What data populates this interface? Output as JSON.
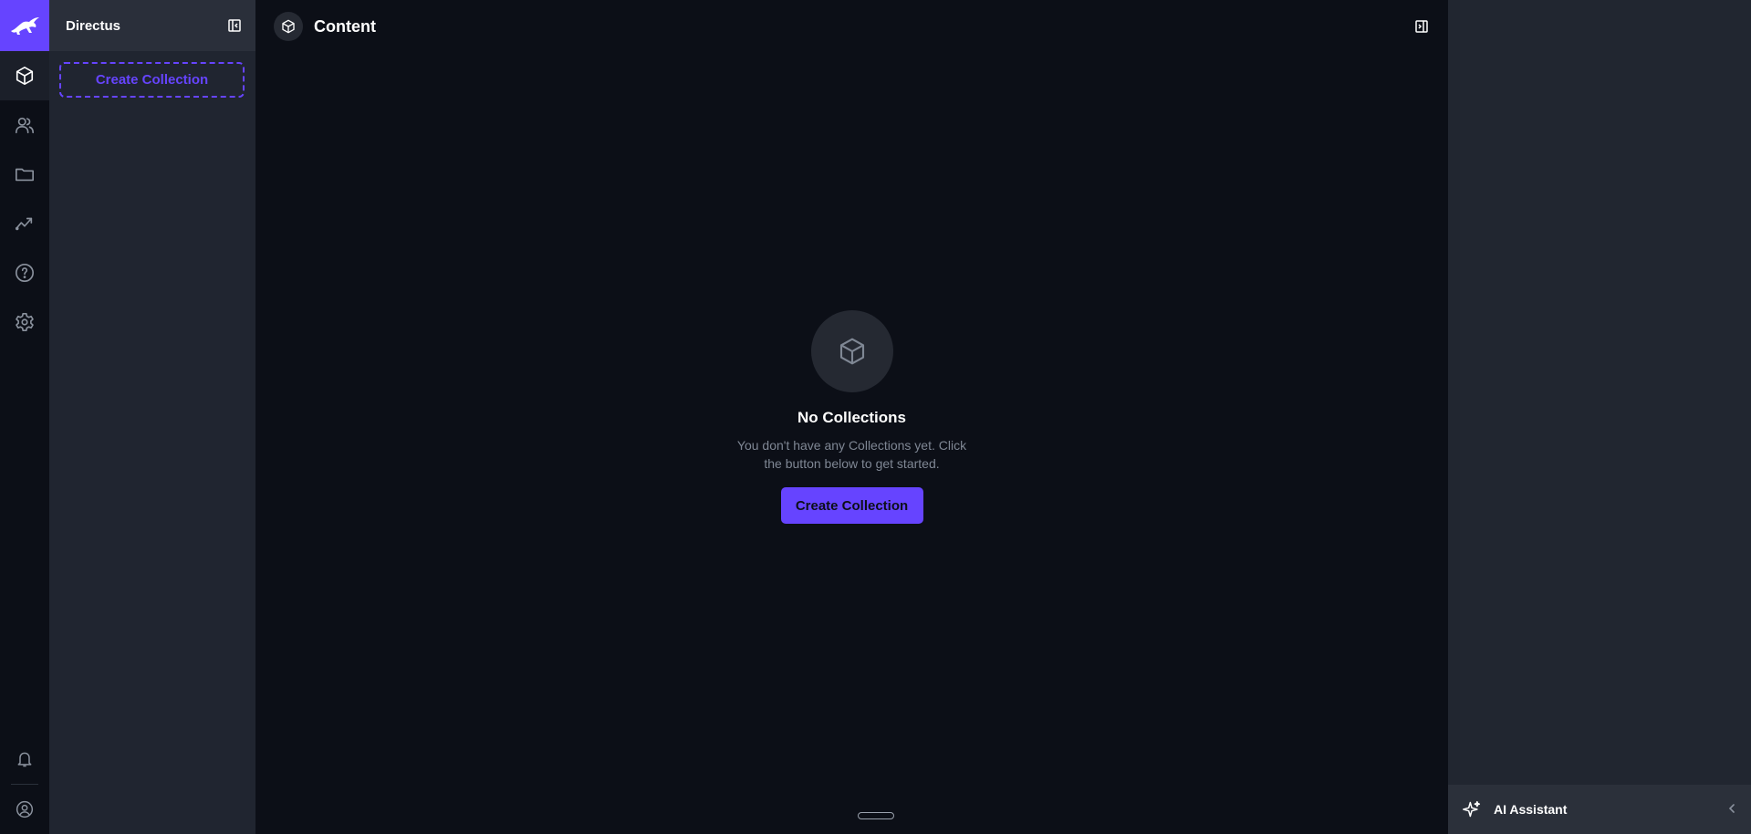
{
  "app": {
    "project_name": "Directus",
    "accent_color": "#6644ff"
  },
  "module_bar": {
    "icons": [
      "rabbit-logo-icon",
      "cube-icon",
      "users-icon",
      "folder-icon",
      "insights-icon",
      "help-icon",
      "settings-icon",
      "bell-icon",
      "user-circle-icon"
    ]
  },
  "navigation": {
    "title": "Directus",
    "create_collection_label": "Create Collection"
  },
  "header": {
    "title": "Content"
  },
  "empty_state": {
    "title": "No Collections",
    "text": "You don't have any Collections yet. Click the button below to get started.",
    "button_label": "Create Collection"
  },
  "right_sidebar": {
    "ai_label": "AI Assistant"
  }
}
